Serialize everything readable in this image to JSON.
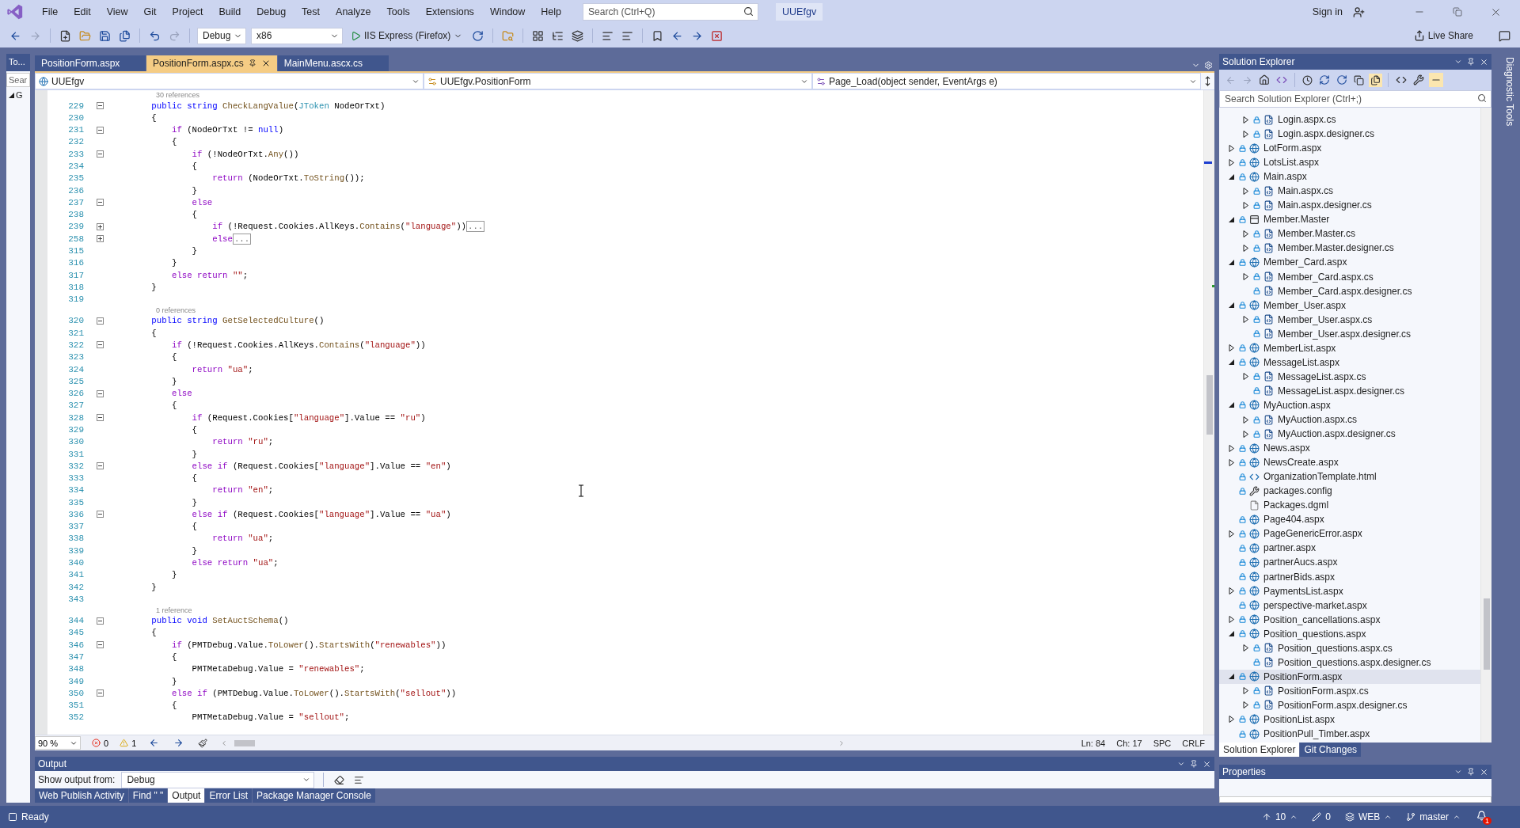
{
  "menu": {
    "items": [
      "File",
      "Edit",
      "View",
      "Git",
      "Project",
      "Build",
      "Debug",
      "Test",
      "Analyze",
      "Tools",
      "Extensions",
      "Window",
      "Help"
    ],
    "search": {
      "placeholder": "Search (Ctrl+Q)"
    },
    "solution": "UUEfgv",
    "sign_in": "Sign in"
  },
  "toolbar": {
    "configuration": "Debug",
    "platform": "x86",
    "run_target": "IIS Express (Firefox)",
    "live_share": "Live Share"
  },
  "toolbox": {
    "title": "To...",
    "search": {
      "placeholder": "Sear"
    },
    "node": "G"
  },
  "document_tabs": [
    {
      "label": "PositionForm.aspx",
      "selected": false,
      "pinned": false
    },
    {
      "label": "PositionForm.aspx.cs",
      "selected": true,
      "pinned": true
    },
    {
      "label": "MainMenu.ascx.cs",
      "selected": false,
      "pinned": false
    }
  ],
  "navigation_bar": {
    "project": "UUEfgv",
    "type": "UUEfgv.PositionForm",
    "member": "Page_Load(object sender, EventArgs e)"
  },
  "editor": {
    "lines": [
      {
        "lens": "30 references"
      },
      {
        "num": "229",
        "collapsed": false,
        "code": [
          {
            "kind": "kw",
            "text": "        public string "
          },
          {
            "kind": "m",
            "text": "CheckLangValue"
          },
          {
            "kind": "p",
            "text": "("
          },
          {
            "kind": "type",
            "text": "JToken"
          },
          {
            "kind": "p",
            "text": " NodeOrTxt)"
          }
        ]
      },
      {
        "num": "230",
        "code": [
          {
            "kind": "p",
            "text": "        {"
          }
        ]
      },
      {
        "num": "231",
        "collapsed": false,
        "code": [
          {
            "kind": "ctl",
            "text": "            if"
          },
          {
            "kind": "p",
            "text": " (NodeOrTxt != "
          },
          {
            "kind": "kw",
            "text": "null"
          },
          {
            "kind": "p",
            "text": ")"
          }
        ]
      },
      {
        "num": "232",
        "code": [
          {
            "kind": "p",
            "text": "            {"
          }
        ]
      },
      {
        "num": "233",
        "collapsed": false,
        "code": [
          {
            "kind": "ctl",
            "text": "                if"
          },
          {
            "kind": "p",
            "text": " (!NodeOrTxt."
          },
          {
            "kind": "m",
            "text": "Any"
          },
          {
            "kind": "p",
            "text": "())"
          }
        ]
      },
      {
        "num": "234",
        "code": [
          {
            "kind": "p",
            "text": "                {"
          }
        ]
      },
      {
        "num": "235",
        "code": [
          {
            "kind": "ctl",
            "text": "                    return"
          },
          {
            "kind": "p",
            "text": " (NodeOrTxt."
          },
          {
            "kind": "m",
            "text": "ToString"
          },
          {
            "kind": "p",
            "text": "());"
          }
        ]
      },
      {
        "num": "236",
        "code": [
          {
            "kind": "p",
            "text": "                }"
          }
        ]
      },
      {
        "num": "237",
        "collapsed": false,
        "code": [
          {
            "kind": "ctl",
            "text": "                else"
          }
        ]
      },
      {
        "num": "238",
        "code": [
          {
            "kind": "p",
            "text": "                {"
          }
        ]
      },
      {
        "num": "239",
        "collapsed": true,
        "code": [
          {
            "kind": "ctl",
            "text": "                    if"
          },
          {
            "kind": "p",
            "text": " (!Request.Cookies.AllKeys."
          },
          {
            "kind": "m",
            "text": "Contains"
          },
          {
            "kind": "p",
            "text": "("
          },
          {
            "kind": "str",
            "text": "\"language\""
          },
          {
            "kind": "p",
            "text": "))"
          },
          {
            "kind": "fold",
            "text": "..."
          }
        ]
      },
      {
        "num": "258",
        "collapsed": true,
        "code": [
          {
            "kind": "ctl",
            "text": "                    else"
          },
          {
            "kind": "fold",
            "text": "..."
          }
        ]
      },
      {
        "num": "315",
        "code": [
          {
            "kind": "p",
            "text": "                }"
          }
        ]
      },
      {
        "num": "316",
        "code": [
          {
            "kind": "p",
            "text": "            }"
          }
        ]
      },
      {
        "num": "317",
        "code": [
          {
            "kind": "ctl",
            "text": "            else return "
          },
          {
            "kind": "str",
            "text": "\"\""
          },
          {
            "kind": "p",
            "text": ";"
          }
        ]
      },
      {
        "num": "318",
        "code": [
          {
            "kind": "p",
            "text": "        }"
          }
        ]
      },
      {
        "num": "319"
      },
      {
        "lens": "0 references"
      },
      {
        "num": "320",
        "collapsed": false,
        "code": [
          {
            "kind": "kw",
            "text": "        public string "
          },
          {
            "kind": "m",
            "text": "GetSelectedCulture"
          },
          {
            "kind": "p",
            "text": "()"
          }
        ]
      },
      {
        "num": "321",
        "code": [
          {
            "kind": "p",
            "text": "        {"
          }
        ]
      },
      {
        "num": "322",
        "collapsed": false,
        "code": [
          {
            "kind": "ctl",
            "text": "            if"
          },
          {
            "kind": "p",
            "text": " (!Request.Cookies.AllKeys."
          },
          {
            "kind": "m",
            "text": "Contains"
          },
          {
            "kind": "p",
            "text": "("
          },
          {
            "kind": "str",
            "text": "\"language\""
          },
          {
            "kind": "p",
            "text": "))"
          }
        ]
      },
      {
        "num": "323",
        "code": [
          {
            "kind": "p",
            "text": "            {"
          }
        ]
      },
      {
        "num": "324",
        "code": [
          {
            "kind": "ctl",
            "text": "                return "
          },
          {
            "kind": "str",
            "text": "\"ua\""
          },
          {
            "kind": "p",
            "text": ";"
          }
        ]
      },
      {
        "num": "325",
        "code": [
          {
            "kind": "p",
            "text": "            }"
          }
        ]
      },
      {
        "num": "326",
        "collapsed": false,
        "code": [
          {
            "kind": "ctl",
            "text": "            else"
          }
        ]
      },
      {
        "num": "327",
        "code": [
          {
            "kind": "p",
            "text": "            {"
          }
        ]
      },
      {
        "num": "328",
        "collapsed": false,
        "code": [
          {
            "kind": "ctl",
            "text": "                if"
          },
          {
            "kind": "p",
            "text": " (Request.Cookies["
          },
          {
            "kind": "str",
            "text": "\"language\""
          },
          {
            "kind": "p",
            "text": "].Value == "
          },
          {
            "kind": "str",
            "text": "\"ru\""
          },
          {
            "kind": "p",
            "text": ")"
          }
        ]
      },
      {
        "num": "329",
        "code": [
          {
            "kind": "p",
            "text": "                {"
          }
        ]
      },
      {
        "num": "330",
        "code": [
          {
            "kind": "ctl",
            "text": "                    return "
          },
          {
            "kind": "str",
            "text": "\"ru\""
          },
          {
            "kind": "p",
            "text": ";"
          }
        ]
      },
      {
        "num": "331",
        "code": [
          {
            "kind": "p",
            "text": "                }"
          }
        ]
      },
      {
        "num": "332",
        "collapsed": false,
        "code": [
          {
            "kind": "ctl",
            "text": "                else if"
          },
          {
            "kind": "p",
            "text": " (Request.Cookies["
          },
          {
            "kind": "str",
            "text": "\"language\""
          },
          {
            "kind": "p",
            "text": "].Value == "
          },
          {
            "kind": "str",
            "text": "\"en\""
          },
          {
            "kind": "p",
            "text": ")"
          }
        ]
      },
      {
        "num": "333",
        "code": [
          {
            "kind": "p",
            "text": "                {"
          }
        ]
      },
      {
        "num": "334",
        "code": [
          {
            "kind": "ctl",
            "text": "                    return "
          },
          {
            "kind": "str",
            "text": "\"en\""
          },
          {
            "kind": "p",
            "text": ";"
          }
        ]
      },
      {
        "num": "335",
        "code": [
          {
            "kind": "p",
            "text": "                }"
          }
        ]
      },
      {
        "num": "336",
        "collapsed": false,
        "code": [
          {
            "kind": "ctl",
            "text": "                else if"
          },
          {
            "kind": "p",
            "text": " (Request.Cookies["
          },
          {
            "kind": "str",
            "text": "\"language\""
          },
          {
            "kind": "p",
            "text": "].Value == "
          },
          {
            "kind": "str",
            "text": "\"ua\""
          },
          {
            "kind": "p",
            "text": ")"
          }
        ]
      },
      {
        "num": "337",
        "code": [
          {
            "kind": "p",
            "text": "                {"
          }
        ]
      },
      {
        "num": "338",
        "code": [
          {
            "kind": "ctl",
            "text": "                    return "
          },
          {
            "kind": "str",
            "text": "\"ua\""
          },
          {
            "kind": "p",
            "text": ";"
          }
        ]
      },
      {
        "num": "339",
        "code": [
          {
            "kind": "p",
            "text": "                }"
          }
        ]
      },
      {
        "num": "340",
        "code": [
          {
            "kind": "ctl",
            "text": "                else return "
          },
          {
            "kind": "str",
            "text": "\"ua\""
          },
          {
            "kind": "p",
            "text": ";"
          }
        ]
      },
      {
        "num": "341",
        "code": [
          {
            "kind": "p",
            "text": "            }"
          }
        ]
      },
      {
        "num": "342",
        "code": [
          {
            "kind": "p",
            "text": "        }"
          }
        ]
      },
      {
        "num": "343"
      },
      {
        "lens": "1 reference"
      },
      {
        "num": "344",
        "collapsed": false,
        "code": [
          {
            "kind": "kw",
            "text": "        public void "
          },
          {
            "kind": "m",
            "text": "SetAuctSchema"
          },
          {
            "kind": "p",
            "text": "()"
          }
        ]
      },
      {
        "num": "345",
        "code": [
          {
            "kind": "p",
            "text": "        {"
          }
        ]
      },
      {
        "num": "346",
        "collapsed": false,
        "code": [
          {
            "kind": "ctl",
            "text": "            if"
          },
          {
            "kind": "p",
            "text": " (PMTDebug.Value."
          },
          {
            "kind": "m",
            "text": "ToLower"
          },
          {
            "kind": "p",
            "text": "()."
          },
          {
            "kind": "m",
            "text": "StartsWith"
          },
          {
            "kind": "p",
            "text": "("
          },
          {
            "kind": "str",
            "text": "\"renewables\""
          },
          {
            "kind": "p",
            "text": "))"
          }
        ]
      },
      {
        "num": "347",
        "code": [
          {
            "kind": "p",
            "text": "            {"
          }
        ]
      },
      {
        "num": "348",
        "code": [
          {
            "kind": "p",
            "text": "                PMTMetaDebug.Value = "
          },
          {
            "kind": "str",
            "text": "\"renewables\""
          },
          {
            "kind": "p",
            "text": ";"
          }
        ]
      },
      {
        "num": "349",
        "code": [
          {
            "kind": "p",
            "text": "            }"
          }
        ]
      },
      {
        "num": "350",
        "collapsed": false,
        "code": [
          {
            "kind": "ctl",
            "text": "            else if"
          },
          {
            "kind": "p",
            "text": " (PMTDebug.Value."
          },
          {
            "kind": "m",
            "text": "ToLower"
          },
          {
            "kind": "p",
            "text": "()."
          },
          {
            "kind": "m",
            "text": "StartsWith"
          },
          {
            "kind": "p",
            "text": "("
          },
          {
            "kind": "str",
            "text": "\"sellout\""
          },
          {
            "kind": "p",
            "text": "))"
          }
        ]
      },
      {
        "num": "351",
        "code": [
          {
            "kind": "p",
            "text": "            {"
          }
        ]
      },
      {
        "num": "352",
        "code": [
          {
            "kind": "p",
            "text": "                PMTMetaDebug.Value = "
          },
          {
            "kind": "str",
            "text": "\"sellout\""
          },
          {
            "kind": "p",
            "text": ";"
          }
        ]
      }
    ]
  },
  "editor_status": {
    "zoom": "90 %",
    "errors": "0",
    "warnings": "1",
    "line": "Ln: 84",
    "column": "Ch: 17",
    "whitespace": "SPC",
    "line_ending": "CRLF"
  },
  "output": {
    "title": "Output",
    "show_from_label": "Show output from:",
    "source": "Debug",
    "tabs": [
      {
        "label": "Web Publish Activity",
        "selected": false
      },
      {
        "label": "Find \" \"",
        "selected": false
      },
      {
        "label": "Output",
        "selected": true
      },
      {
        "label": "Error List",
        "selected": false
      },
      {
        "label": "Package Manager Console",
        "selected": false
      }
    ]
  },
  "solution_explorer": {
    "title": "Solution Explorer",
    "search": {
      "placeholder": "Search Solution Explorer (Ctrl+;)"
    },
    "tree": [
      {
        "children": [
          {
            "label": "Login.aspx.cs",
            "kind": "cs",
            "expanded": false,
            "locked": true,
            "selected": false
          },
          {
            "label": "Login.aspx.designer.cs",
            "kind": "cs",
            "expanded": false,
            "locked": true,
            "selected": false
          }
        ]
      },
      {
        "label": "LotForm.aspx",
        "kind": "web",
        "expanded": false,
        "locked": true,
        "selected": false
      },
      {
        "label": "LotsList.aspx",
        "kind": "web",
        "expanded": false,
        "locked": true,
        "selected": false
      },
      {
        "label": "Main.aspx",
        "kind": "web",
        "expanded": true,
        "locked": true,
        "selected": false,
        "children": [
          {
            "label": "Main.aspx.cs",
            "kind": "cs",
            "expanded": false,
            "locked": true,
            "selected": false
          },
          {
            "label": "Main.aspx.designer.cs",
            "kind": "cs",
            "expanded": false,
            "locked": true,
            "selected": false
          }
        ]
      },
      {
        "label": "Member.Master",
        "kind": "master",
        "expanded": true,
        "locked": true,
        "selected": false,
        "children": [
          {
            "label": "Member.Master.cs",
            "kind": "cs",
            "expanded": false,
            "locked": true,
            "selected": false
          },
          {
            "label": "Member.Master.designer.cs",
            "kind": "cs",
            "expanded": false,
            "locked": true,
            "selected": false
          }
        ]
      },
      {
        "label": "Member_Card.aspx",
        "kind": "web",
        "expanded": true,
        "locked": true,
        "selected": false,
        "children": [
          {
            "label": "Member_Card.aspx.cs",
            "kind": "cs",
            "expanded": false,
            "locked": true,
            "selected": false
          },
          {
            "label": "Member_Card.aspx.designer.cs",
            "kind": "cs",
            "locked": true,
            "selected": false
          }
        ]
      },
      {
        "label": "Member_User.aspx",
        "kind": "web",
        "expanded": true,
        "locked": true,
        "selected": false,
        "children": [
          {
            "label": "Member_User.aspx.cs",
            "kind": "cs",
            "expanded": false,
            "locked": true,
            "selected": false
          },
          {
            "label": "Member_User.aspx.designer.cs",
            "kind": "cs",
            "locked": true,
            "selected": false
          }
        ]
      },
      {
        "label": "MemberList.aspx",
        "kind": "web",
        "expanded": false,
        "locked": true,
        "selected": false
      },
      {
        "label": "MessageList.aspx",
        "kind": "web",
        "expanded": true,
        "locked": true,
        "selected": false,
        "children": [
          {
            "label": "MessageList.aspx.cs",
            "kind": "cs",
            "expanded": false,
            "locked": true,
            "selected": false
          },
          {
            "label": "MessageList.aspx.designer.cs",
            "kind": "cs",
            "locked": true,
            "selected": false
          }
        ]
      },
      {
        "label": "MyAuction.aspx",
        "kind": "web",
        "expanded": true,
        "locked": true,
        "selected": false,
        "children": [
          {
            "label": "MyAuction.aspx.cs",
            "kind": "cs",
            "expanded": false,
            "locked": true,
            "selected": false
          },
          {
            "label": "MyAuction.aspx.designer.cs",
            "kind": "cs",
            "expanded": false,
            "locked": true,
            "selected": false
          }
        ]
      },
      {
        "label": "News.aspx",
        "kind": "web",
        "expanded": false,
        "locked": true,
        "selected": false
      },
      {
        "label": "NewsCreate.aspx",
        "kind": "web",
        "expanded": false,
        "locked": true,
        "selected": false
      },
      {
        "label": "OrganizationTemplate.html",
        "kind": "html",
        "locked": true,
        "selected": false
      },
      {
        "label": "packages.config",
        "kind": "config",
        "locked": true,
        "selected": false
      },
      {
        "label": "Packages.dgml",
        "kind": "dgml",
        "locked": false,
        "selected": false
      },
      {
        "label": "Page404.aspx",
        "kind": "web",
        "locked": true,
        "selected": false
      },
      {
        "label": "PageGenericError.aspx",
        "kind": "web",
        "expanded": false,
        "locked": true,
        "selected": false
      },
      {
        "label": "partner.aspx",
        "kind": "web",
        "locked": true,
        "selected": false
      },
      {
        "label": "partnerAucs.aspx",
        "kind": "web",
        "locked": true,
        "selected": false
      },
      {
        "label": "partnerBids.aspx",
        "kind": "web",
        "locked": true,
        "selected": false
      },
      {
        "label": "PaymentsList.aspx",
        "kind": "web",
        "expanded": false,
        "locked": true,
        "selected": false
      },
      {
        "label": "perspective-market.aspx",
        "kind": "web",
        "locked": true,
        "selected": false
      },
      {
        "label": "Position_cancellations.aspx",
        "kind": "web",
        "expanded": false,
        "locked": true,
        "selected": false
      },
      {
        "label": "Position_questions.aspx",
        "kind": "web",
        "expanded": true,
        "locked": true,
        "selected": false,
        "children": [
          {
            "label": "Position_questions.aspx.cs",
            "kind": "cs",
            "expanded": false,
            "locked": true,
            "selected": false
          },
          {
            "label": "Position_questions.aspx.designer.cs",
            "kind": "cs",
            "locked": true,
            "selected": false
          }
        ]
      },
      {
        "label": "PositionForm.aspx",
        "kind": "web",
        "expanded": true,
        "locked": true,
        "selected": true,
        "children": [
          {
            "label": "PositionForm.aspx.cs",
            "kind": "cs",
            "expanded": false,
            "locked": true,
            "selected": false
          },
          {
            "label": "PositionForm.aspx.designer.cs",
            "kind": "cs",
            "expanded": false,
            "locked": true,
            "selected": false
          }
        ]
      },
      {
        "label": "PositionList.aspx",
        "kind": "web",
        "expanded": false,
        "locked": true,
        "selected": false
      },
      {
        "label": "PositionPull_Timber.aspx",
        "kind": "web",
        "locked": true,
        "selected": false
      }
    ],
    "tabs": [
      {
        "label": "Solution Explorer",
        "selected": true
      },
      {
        "label": "Git Changes",
        "selected": false
      }
    ]
  },
  "properties": {
    "title": "Properties"
  },
  "side_tabs": [
    "Diagnostic Tools"
  ],
  "status_bar": {
    "text": "Ready",
    "commits": "10",
    "changes": "0",
    "repository": "WEB",
    "branch": "master",
    "notifications": "1"
  }
}
